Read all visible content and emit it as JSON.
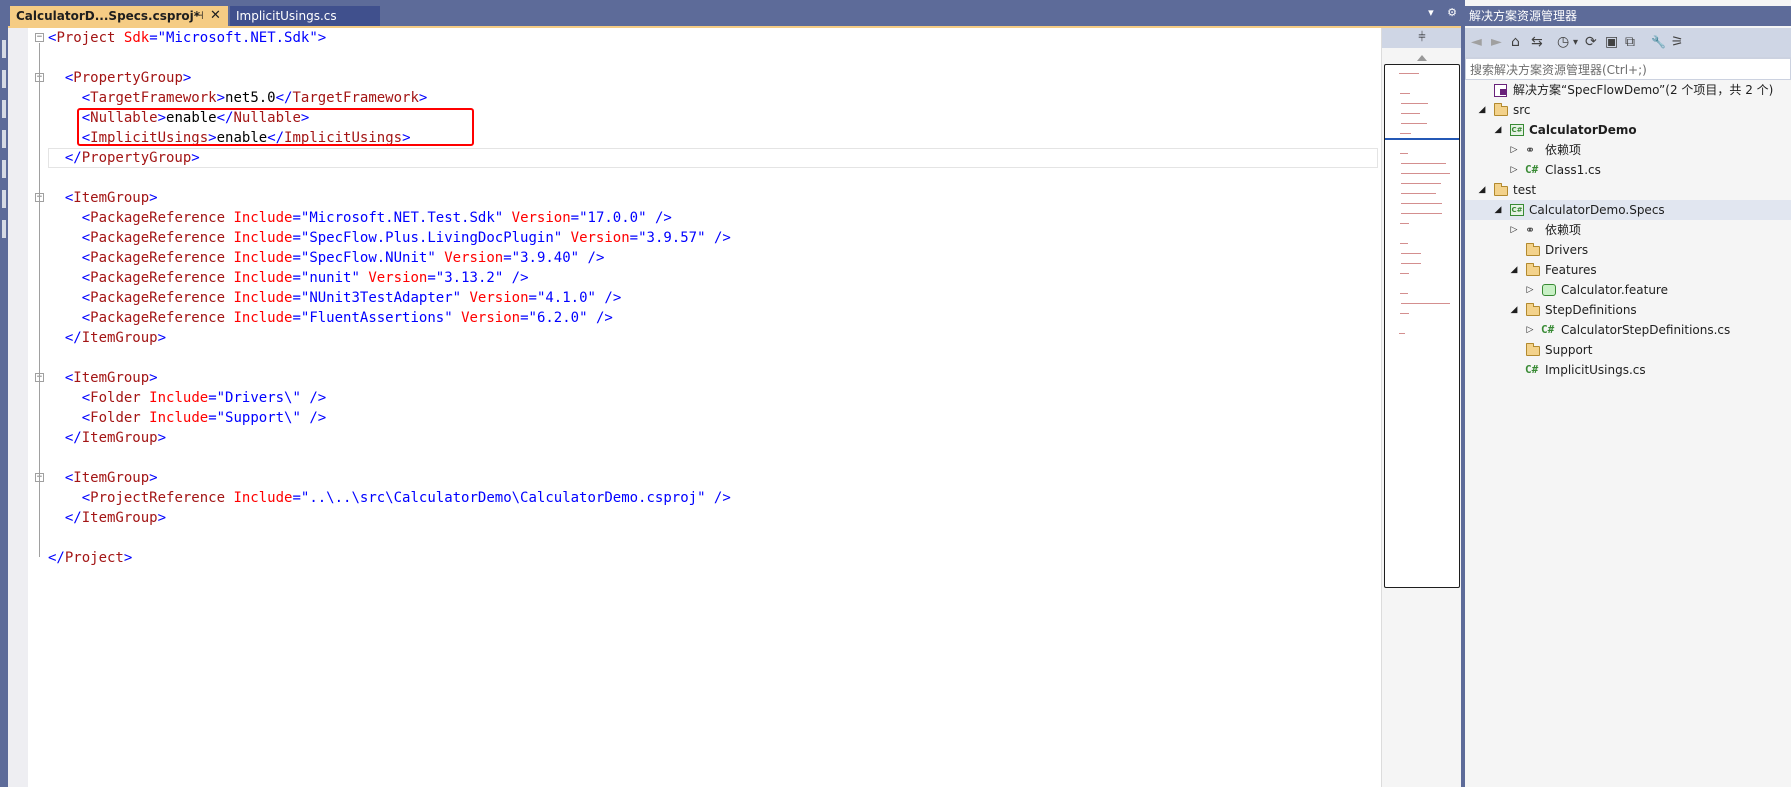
{
  "tabs": {
    "active": {
      "label": "CalculatorD...Specs.csproj*",
      "pin": "⊣",
      "close": "✕"
    },
    "inactive": {
      "label": "ImplicitUsings.cs"
    },
    "tools": {
      "dropdown": "▾",
      "settings": "⚙"
    }
  },
  "editor": {
    "lines": [
      [
        [
          "b",
          "<"
        ],
        [
          "t",
          "Project"
        ],
        [
          "t",
          " "
        ],
        [
          "a",
          "Sdk"
        ],
        [
          "b",
          "=\""
        ],
        [
          "v",
          "Microsoft.NET.Sdk"
        ],
        [
          "b",
          "\">"
        ]
      ],
      [],
      [
        [
          "x",
          "  "
        ],
        [
          "b",
          "<"
        ],
        [
          "t",
          "PropertyGroup"
        ],
        [
          "b",
          ">"
        ]
      ],
      [
        [
          "x",
          "    "
        ],
        [
          "b",
          "<"
        ],
        [
          "t",
          "TargetFramework"
        ],
        [
          "b",
          ">"
        ],
        [
          "x",
          "net5.0"
        ],
        [
          "b",
          "</"
        ],
        [
          "t",
          "TargetFramework"
        ],
        [
          "b",
          ">"
        ]
      ],
      [
        [
          "x",
          "    "
        ],
        [
          "b",
          "<"
        ],
        [
          "t",
          "Nullable"
        ],
        [
          "b",
          ">"
        ],
        [
          "x",
          "enable"
        ],
        [
          "b",
          "</"
        ],
        [
          "t",
          "Nullable"
        ],
        [
          "b",
          ">"
        ]
      ],
      [
        [
          "x",
          "    "
        ],
        [
          "b",
          "<"
        ],
        [
          "t",
          "ImplicitUsings"
        ],
        [
          "b",
          ">"
        ],
        [
          "x",
          "enable"
        ],
        [
          "b",
          "</"
        ],
        [
          "t",
          "ImplicitUsings"
        ],
        [
          "b",
          ">"
        ]
      ],
      [
        [
          "x",
          "  "
        ],
        [
          "b",
          "</"
        ],
        [
          "t",
          "PropertyGroup"
        ],
        [
          "b",
          ">"
        ]
      ],
      [],
      [
        [
          "x",
          "  "
        ],
        [
          "b",
          "<"
        ],
        [
          "t",
          "ItemGroup"
        ],
        [
          "b",
          ">"
        ]
      ],
      [
        [
          "x",
          "    "
        ],
        [
          "b",
          "<"
        ],
        [
          "t",
          "PackageReference"
        ],
        [
          "x",
          " "
        ],
        [
          "a",
          "Include"
        ],
        [
          "b",
          "=\""
        ],
        [
          "v",
          "Microsoft.NET.Test.Sdk"
        ],
        [
          "b",
          "\""
        ],
        [
          "x",
          " "
        ],
        [
          "a",
          "Version"
        ],
        [
          "b",
          "=\""
        ],
        [
          "v",
          "17.0.0"
        ],
        [
          "b",
          "\" />"
        ]
      ],
      [
        [
          "x",
          "    "
        ],
        [
          "b",
          "<"
        ],
        [
          "t",
          "PackageReference"
        ],
        [
          "x",
          " "
        ],
        [
          "a",
          "Include"
        ],
        [
          "b",
          "=\""
        ],
        [
          "v",
          "SpecFlow.Plus.LivingDocPlugin"
        ],
        [
          "b",
          "\""
        ],
        [
          "x",
          " "
        ],
        [
          "a",
          "Version"
        ],
        [
          "b",
          "=\""
        ],
        [
          "v",
          "3.9.57"
        ],
        [
          "b",
          "\" />"
        ]
      ],
      [
        [
          "x",
          "    "
        ],
        [
          "b",
          "<"
        ],
        [
          "t",
          "PackageReference"
        ],
        [
          "x",
          " "
        ],
        [
          "a",
          "Include"
        ],
        [
          "b",
          "=\""
        ],
        [
          "v",
          "SpecFlow.NUnit"
        ],
        [
          "b",
          "\""
        ],
        [
          "x",
          " "
        ],
        [
          "a",
          "Version"
        ],
        [
          "b",
          "=\""
        ],
        [
          "v",
          "3.9.40"
        ],
        [
          "b",
          "\" />"
        ]
      ],
      [
        [
          "x",
          "    "
        ],
        [
          "b",
          "<"
        ],
        [
          "t",
          "PackageReference"
        ],
        [
          "x",
          " "
        ],
        [
          "a",
          "Include"
        ],
        [
          "b",
          "=\""
        ],
        [
          "v",
          "nunit"
        ],
        [
          "b",
          "\""
        ],
        [
          "x",
          " "
        ],
        [
          "a",
          "Version"
        ],
        [
          "b",
          "=\""
        ],
        [
          "v",
          "3.13.2"
        ],
        [
          "b",
          "\" />"
        ]
      ],
      [
        [
          "x",
          "    "
        ],
        [
          "b",
          "<"
        ],
        [
          "t",
          "PackageReference"
        ],
        [
          "x",
          " "
        ],
        [
          "a",
          "Include"
        ],
        [
          "b",
          "=\""
        ],
        [
          "v",
          "NUnit3TestAdapter"
        ],
        [
          "b",
          "\""
        ],
        [
          "x",
          " "
        ],
        [
          "a",
          "Version"
        ],
        [
          "b",
          "=\""
        ],
        [
          "v",
          "4.1.0"
        ],
        [
          "b",
          "\" />"
        ]
      ],
      [
        [
          "x",
          "    "
        ],
        [
          "b",
          "<"
        ],
        [
          "t",
          "PackageReference"
        ],
        [
          "x",
          " "
        ],
        [
          "a",
          "Include"
        ],
        [
          "b",
          "=\""
        ],
        [
          "v",
          "FluentAssertions"
        ],
        [
          "b",
          "\""
        ],
        [
          "x",
          " "
        ],
        [
          "a",
          "Version"
        ],
        [
          "b",
          "=\""
        ],
        [
          "v",
          "6.2.0"
        ],
        [
          "b",
          "\" />"
        ]
      ],
      [
        [
          "x",
          "  "
        ],
        [
          "b",
          "</"
        ],
        [
          "t",
          "ItemGroup"
        ],
        [
          "b",
          ">"
        ]
      ],
      [],
      [
        [
          "x",
          "  "
        ],
        [
          "b",
          "<"
        ],
        [
          "t",
          "ItemGroup"
        ],
        [
          "b",
          ">"
        ]
      ],
      [
        [
          "x",
          "    "
        ],
        [
          "b",
          "<"
        ],
        [
          "t",
          "Folder"
        ],
        [
          "x",
          " "
        ],
        [
          "a",
          "Include"
        ],
        [
          "b",
          "=\""
        ],
        [
          "v",
          "Drivers\\"
        ],
        [
          "b",
          "\" />"
        ]
      ],
      [
        [
          "x",
          "    "
        ],
        [
          "b",
          "<"
        ],
        [
          "t",
          "Folder"
        ],
        [
          "x",
          " "
        ],
        [
          "a",
          "Include"
        ],
        [
          "b",
          "=\""
        ],
        [
          "v",
          "Support\\"
        ],
        [
          "b",
          "\" />"
        ]
      ],
      [
        [
          "x",
          "  "
        ],
        [
          "b",
          "</"
        ],
        [
          "t",
          "ItemGroup"
        ],
        [
          "b",
          ">"
        ]
      ],
      [],
      [
        [
          "x",
          "  "
        ],
        [
          "b",
          "<"
        ],
        [
          "t",
          "ItemGroup"
        ],
        [
          "b",
          ">"
        ]
      ],
      [
        [
          "x",
          "    "
        ],
        [
          "b",
          "<"
        ],
        [
          "t",
          "ProjectReference"
        ],
        [
          "x",
          " "
        ],
        [
          "a",
          "Include"
        ],
        [
          "b",
          "=\""
        ],
        [
          "v",
          "..\\..\\src\\CalculatorDemo\\CalculatorDemo.csproj"
        ],
        [
          "b",
          "\" />"
        ]
      ],
      [
        [
          "x",
          "  "
        ],
        [
          "b",
          "</"
        ],
        [
          "t",
          "ItemGroup"
        ],
        [
          "b",
          ">"
        ]
      ],
      [],
      [
        [
          "b",
          "</"
        ],
        [
          "t",
          "Project"
        ],
        [
          "b",
          ">"
        ]
      ]
    ],
    "fold_lines": [
      0,
      2,
      8,
      17,
      22
    ],
    "fold_glyph": "−"
  },
  "minimap": {
    "splitter_glyph": "⫩"
  },
  "solution_explorer": {
    "title": "解决方案资源管理器",
    "search_placeholder": "搜索解决方案资源管理器(Ctrl+;)",
    "toolbar": {
      "back": "◄",
      "forward": "►",
      "home": "⌂",
      "switch_view": "⇆",
      "history": "◷",
      "history_dropdown": "▾",
      "refresh": "⟳",
      "collapse": "▣",
      "show_all": "⧉",
      "properties": "🔧",
      "preview": "⚞"
    },
    "tree": [
      {
        "depth": 0,
        "expander": "",
        "icon": "sln",
        "label": "解决方案“SpecFlowDemo”(2 个项目，共 2 个)",
        "bold": false
      },
      {
        "depth": 0,
        "expander": "◢",
        "icon": "folder",
        "label": "src",
        "bold": false
      },
      {
        "depth": 1,
        "expander": "◢",
        "icon": "proj",
        "label": "CalculatorDemo",
        "bold": true
      },
      {
        "depth": 2,
        "expander": "▷",
        "icon": "deps",
        "label": "依赖项",
        "bold": false
      },
      {
        "depth": 2,
        "expander": "▷",
        "icon": "cs",
        "label": "Class1.cs",
        "bold": false
      },
      {
        "depth": 0,
        "expander": "◢",
        "icon": "folder",
        "label": "test",
        "bold": false
      },
      {
        "depth": 1,
        "expander": "◢",
        "icon": "proj",
        "label": "CalculatorDemo.Specs",
        "bold": false,
        "selected": true
      },
      {
        "depth": 2,
        "expander": "▷",
        "icon": "deps",
        "label": "依赖项",
        "bold": false
      },
      {
        "depth": 2,
        "expander": "",
        "icon": "folder",
        "label": "Drivers",
        "bold": false
      },
      {
        "depth": 2,
        "expander": "◢",
        "icon": "folder",
        "label": "Features",
        "bold": false
      },
      {
        "depth": 3,
        "expander": "▷",
        "icon": "feature",
        "label": "Calculator.feature",
        "bold": false
      },
      {
        "depth": 2,
        "expander": "◢",
        "icon": "folder",
        "label": "StepDefinitions",
        "bold": false
      },
      {
        "depth": 3,
        "expander": "▷",
        "icon": "cs",
        "label": "CalculatorStepDefinitions.cs",
        "bold": false
      },
      {
        "depth": 2,
        "expander": "",
        "icon": "folder",
        "label": "Support",
        "bold": false
      },
      {
        "depth": 2,
        "expander": "",
        "icon": "cs",
        "label": "ImplicitUsings.cs",
        "bold": false
      }
    ]
  }
}
